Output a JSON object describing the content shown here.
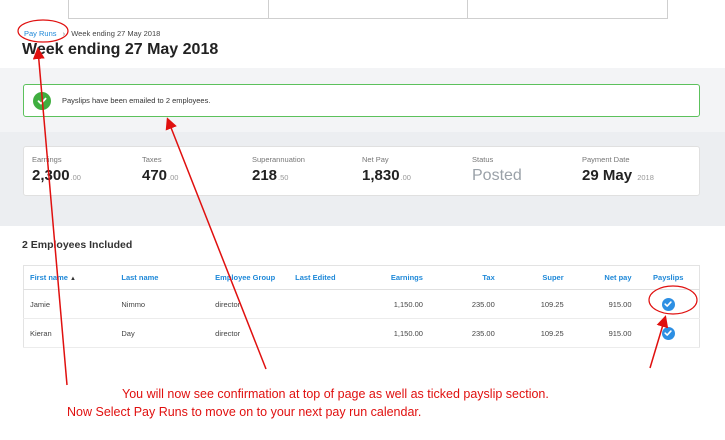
{
  "breadcrumb": {
    "link": "Pay Runs",
    "current": "Week ending 27 May 2018"
  },
  "page_title": "Week ending 27 May 2018",
  "alert": {
    "message": "Payslips have been emailed to 2 employees."
  },
  "summary": [
    {
      "label": "Earnings",
      "value": "2,300",
      "cents": ".00"
    },
    {
      "label": "Taxes",
      "value": "470",
      "cents": ".00"
    },
    {
      "label": "Superannuation",
      "value": "218",
      "cents": ".50"
    },
    {
      "label": "Net Pay",
      "value": "1,830",
      "cents": ".00"
    },
    {
      "label": "Status",
      "value": "Posted",
      "cents": ""
    },
    {
      "label": "Payment Date",
      "value": "29 May",
      "cents": "2018"
    }
  ],
  "employees": {
    "title": "2 Employees Included",
    "columns": [
      "First name",
      "Last name",
      "Employee Group",
      "Last Edited",
      "Earnings",
      "Tax",
      "Super",
      "Net pay",
      "Payslips"
    ],
    "sort_indicator": "▲",
    "rows": [
      {
        "first": "Jamie",
        "last": "Nimmo",
        "group": "director",
        "edited": "",
        "earnings": "1,150.00",
        "tax": "235.00",
        "super": "109.25",
        "net": "915.00",
        "payslip_sent": true
      },
      {
        "first": "Kieran",
        "last": "Day",
        "group": "director",
        "edited": "",
        "earnings": "1,150.00",
        "tax": "235.00",
        "super": "109.25",
        "net": "915.00",
        "payslip_sent": true
      }
    ]
  },
  "annotations": {
    "line1": "You will now see confirmation at top of page as well as ticked payslip section.",
    "line2": "Now Select Pay Runs to move on to your next pay run calendar."
  },
  "colors": {
    "link": "#1e88d8",
    "success": "#3fae3f",
    "annotation": "#e0100f",
    "tick": "#2d8fe3"
  },
  "icons": {
    "alert": "check-circle-icon",
    "payslip": "check-circle-icon",
    "sort": "sort-asc-icon"
  }
}
